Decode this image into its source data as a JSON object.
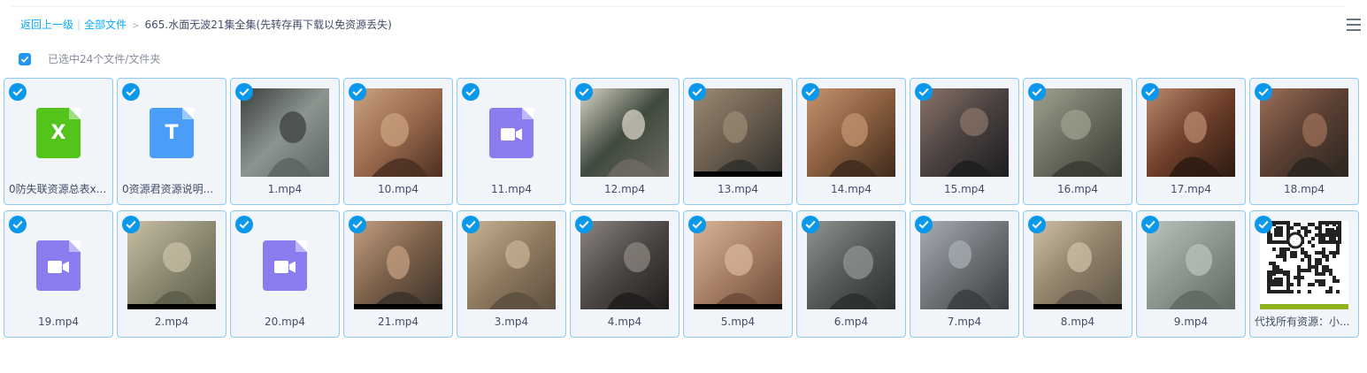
{
  "breadcrumb": {
    "back": "返回上一级",
    "all_files": "全部文件",
    "separator": "|",
    "arrow": ">",
    "current": "665.水面无波21集全集(先转存再下载以免资源丢失)"
  },
  "selection": {
    "text": "已选中24个文件/文件夹",
    "all_checked": true
  },
  "colors": {
    "accent": "#09aaff",
    "check": "#0b97ea",
    "tile_bg": "#f1f5fa",
    "tile_border": "#90c8f0",
    "excel": "#52c41a",
    "text_doc": "#4a9ef8",
    "video": "#8b7cf0"
  },
  "files": [
    {
      "name": "0防失联资源总表x...",
      "kind": "excel-file",
      "glyph": "X"
    },
    {
      "name": "0资源君资源说明...",
      "kind": "text-file",
      "glyph": "T"
    },
    {
      "name": "1.mp4",
      "kind": "video-thumbnail"
    },
    {
      "name": "10.mp4",
      "kind": "video-thumbnail"
    },
    {
      "name": "11.mp4",
      "kind": "video-file"
    },
    {
      "name": "12.mp4",
      "kind": "video-thumbnail"
    },
    {
      "name": "13.mp4",
      "kind": "video-thumbnail"
    },
    {
      "name": "14.mp4",
      "kind": "video-thumbnail"
    },
    {
      "name": "15.mp4",
      "kind": "video-thumbnail"
    },
    {
      "name": "16.mp4",
      "kind": "video-thumbnail"
    },
    {
      "name": "17.mp4",
      "kind": "video-thumbnail"
    },
    {
      "name": "18.mp4",
      "kind": "video-thumbnail"
    },
    {
      "name": "19.mp4",
      "kind": "video-file"
    },
    {
      "name": "2.mp4",
      "kind": "video-thumbnail"
    },
    {
      "name": "20.mp4",
      "kind": "video-file"
    },
    {
      "name": "21.mp4",
      "kind": "video-thumbnail"
    },
    {
      "name": "3.mp4",
      "kind": "video-thumbnail"
    },
    {
      "name": "4.mp4",
      "kind": "video-thumbnail"
    },
    {
      "name": "5.mp4",
      "kind": "video-thumbnail"
    },
    {
      "name": "6.mp4",
      "kind": "video-thumbnail"
    },
    {
      "name": "7.mp4",
      "kind": "video-thumbnail"
    },
    {
      "name": "8.mp4",
      "kind": "video-thumbnail"
    },
    {
      "name": "9.mp4",
      "kind": "video-thumbnail"
    },
    {
      "name": "代找所有资源：小...",
      "kind": "qr-image"
    }
  ]
}
